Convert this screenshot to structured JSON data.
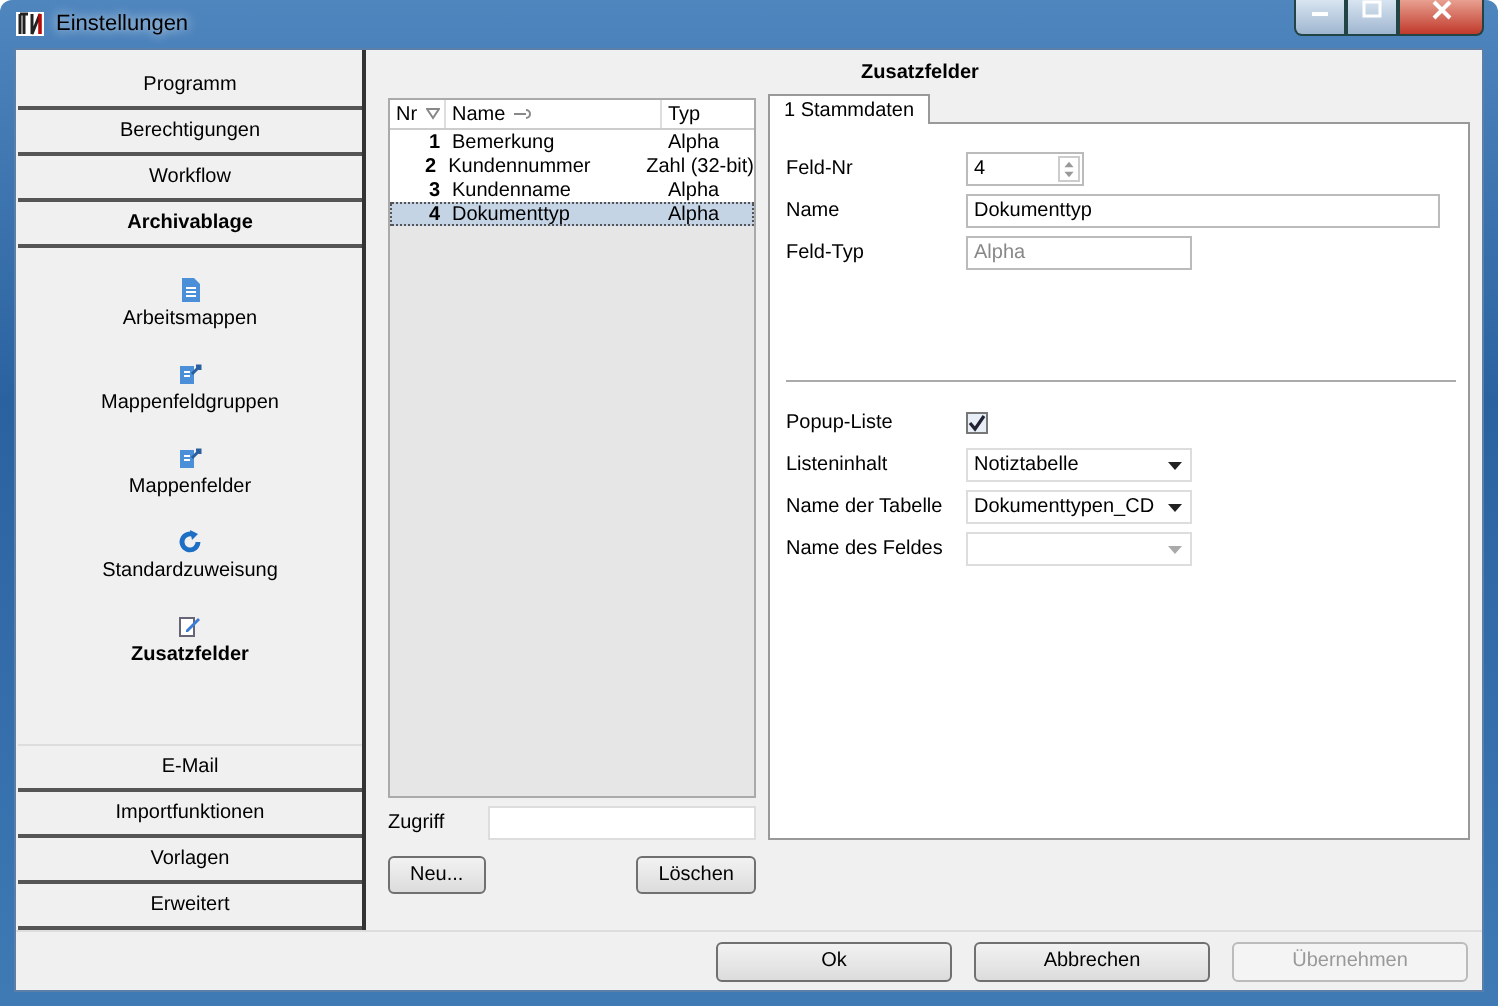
{
  "window": {
    "title": "Einstellungen"
  },
  "sidebar": {
    "sections": [
      {
        "label": "Programm",
        "expanded": false
      },
      {
        "label": "Berechtigungen",
        "expanded": false
      },
      {
        "label": "Workflow",
        "expanded": false
      },
      {
        "label": "Archivablage",
        "expanded": true,
        "items": [
          {
            "label": "Arbeitsmappen",
            "kind": "document",
            "selected": false
          },
          {
            "label": "Mappenfeldgruppen",
            "kind": "folder",
            "selected": false
          },
          {
            "label": "Mappenfelder",
            "kind": "folder",
            "selected": false
          },
          {
            "label": "Standardzuweisung",
            "kind": "refresh",
            "selected": false
          },
          {
            "label": "Zusatzfelder",
            "kind": "edit",
            "selected": true
          }
        ]
      },
      {
        "label": "E-Mail",
        "expanded": false
      },
      {
        "label": "Importfunktionen",
        "expanded": false
      },
      {
        "label": "Vorlagen",
        "expanded": false
      },
      {
        "label": "Erweitert",
        "expanded": false
      }
    ]
  },
  "page_title": "Zusatzfelder",
  "table": {
    "columns": [
      "Nr",
      "Name",
      "Typ"
    ],
    "rows": [
      {
        "nr": "1",
        "name": "Bemerkung",
        "typ": "Alpha",
        "selected": false
      },
      {
        "nr": "2",
        "name": "Kundennummer",
        "typ": "Zahl (32-bit)",
        "selected": false
      },
      {
        "nr": "3",
        "name": "Kundenname",
        "typ": "Alpha",
        "selected": false
      },
      {
        "nr": "4",
        "name": "Dokumenttyp",
        "typ": "Alpha",
        "selected": true
      }
    ]
  },
  "access": {
    "label": "Zugriff"
  },
  "list_buttons": [
    "Neu...",
    "Löschen"
  ],
  "tabs": [
    {
      "label": "1 Stammdaten",
      "selected": true
    }
  ],
  "fields": [
    {
      "kind": "spinner",
      "label": "Feld-Nr",
      "value": "4",
      "disabled": false
    },
    {
      "kind": "text",
      "label": "Name",
      "value": "Dokumenttyp",
      "disabled": false
    },
    {
      "kind": "text",
      "label": "Feld-Typ",
      "value": "Alpha",
      "disabled": true
    }
  ],
  "list_fields": [
    {
      "kind": "checkbox",
      "label": "Popup-Liste",
      "checked": true
    },
    {
      "kind": "dropdown",
      "label": "Listeninhalt",
      "value": "Notiztabelle",
      "disabled": false
    },
    {
      "kind": "dropdown",
      "label": "Name der Tabelle",
      "value": "Dokumenttypen_CD",
      "disabled": false
    },
    {
      "kind": "dropdown",
      "label": "Name des Feldes",
      "disabled": true
    }
  ],
  "buttons": [
    {
      "label": "Ok",
      "disabled": false
    },
    {
      "label": "Abbrechen",
      "disabled": false
    },
    {
      "label": "Übernehmen",
      "disabled": true
    }
  ]
}
